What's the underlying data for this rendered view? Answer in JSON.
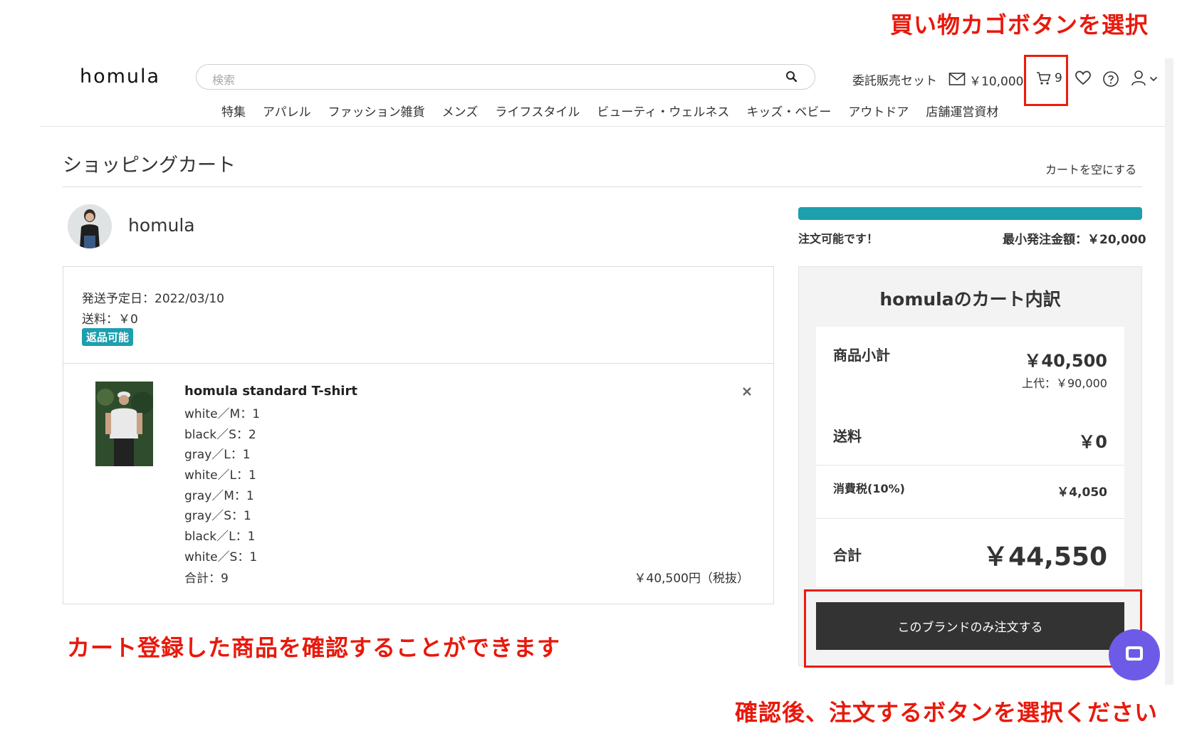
{
  "annotations": {
    "top": "買い物カゴボタンを選択",
    "middle": "カート登録した商品を確認することができます",
    "bottom": "確認後、注文するボタンを選択ください",
    "color": "#e8190c"
  },
  "header": {
    "logo": "homula",
    "search_placeholder": "検索",
    "consign_link": "委託販売セット",
    "balance": "￥10,000",
    "cart_count": "9",
    "icons": [
      "search-icon",
      "mail-icon",
      "cart-icon",
      "heart-icon",
      "help-icon",
      "user-icon",
      "chevron-down-icon"
    ]
  },
  "nav": [
    "特集",
    "アパレル",
    "ファッション雑貨",
    "メンズ",
    "ライフスタイル",
    "ビューティ・ウェルネス",
    "キッズ・ベビー",
    "アウトドア",
    "店舗運営資材"
  ],
  "cart": {
    "title": "ショッピングカート",
    "empty_link": "カートを空にする",
    "brand": "homula",
    "shipping_date": "発送予定日：2022/03/10",
    "shipping_fee": "送料：￥0",
    "return_badge": "返品可能",
    "product": {
      "name": "homula standard T-shirt",
      "variants": [
        "white／M：1",
        "black／S：2",
        "gray／L：1",
        "white／L：1",
        "gray／M：1",
        "gray／S：1",
        "black／L：1",
        "white／S：1"
      ],
      "total_qty": "合計：9",
      "price": "￥40,500円（税抜）"
    }
  },
  "progress": {
    "fill_fraction": 1.0,
    "status": "注文可能です！",
    "minimum": "最小発注金額：￥20,000",
    "color": "#1d9fae"
  },
  "summary": {
    "title": "homulaのカート内訳",
    "subtotal_label": "商品小計",
    "subtotal_value": "￥40,500",
    "retail_price": "上代：￥90,000",
    "shipping_label": "送料",
    "shipping_value": "￥0",
    "tax_label": "消費税(10%)",
    "tax_value": "￥4,050",
    "total_label": "合計",
    "total_value": "￥44,550",
    "order_button": "このブランドのみ注文する"
  }
}
